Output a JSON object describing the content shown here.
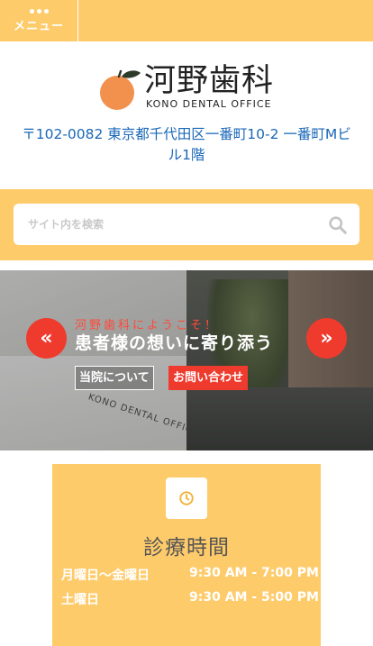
{
  "header": {
    "menu_label": "メニュー"
  },
  "logo": {
    "name_jp": "河野歯科",
    "name_en": "KONO DENTAL OFFICE"
  },
  "address": "〒102-0082 東京都千代田区一番町10-2 一番町Mビル1階",
  "search": {
    "placeholder": "サイト内を検索"
  },
  "hero": {
    "welcome": "河野歯科にようこそ！",
    "title": "患者様の想いに寄り添う",
    "about_button": "当院について",
    "contact_button": "お問い合わせ",
    "prev_arrow": "«",
    "next_arrow": "»",
    "counter_sign": "KONO DENTAL OFFICE"
  },
  "hours": {
    "title": "診療時間",
    "rows": [
      {
        "day": "月曜日〜金曜日",
        "time": "9:30 AM - 7:00 PM"
      },
      {
        "day": "土曜日",
        "time": "9:30 AM - 5:00 PM"
      }
    ]
  },
  "colors": {
    "accent_yellow": "#fecb6b",
    "accent_red": "#ee3b2e",
    "link_blue": "#1a67b8"
  },
  "icons": [
    "dots-icon",
    "orange-logo-icon",
    "search-icon",
    "clock-icon"
  ]
}
